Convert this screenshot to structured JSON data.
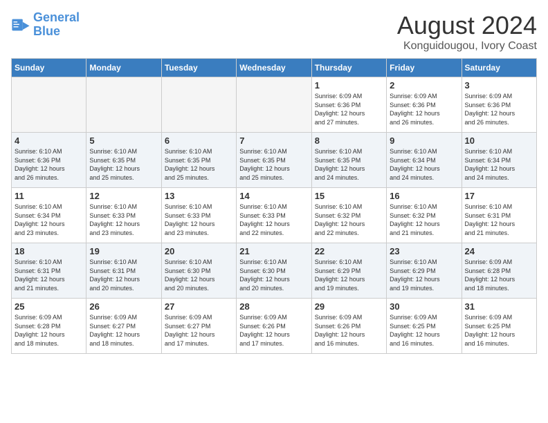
{
  "header": {
    "logo_line1": "General",
    "logo_line2": "Blue",
    "month_title": "August 2024",
    "location": "Konguidougou, Ivory Coast"
  },
  "weekdays": [
    "Sunday",
    "Monday",
    "Tuesday",
    "Wednesday",
    "Thursday",
    "Friday",
    "Saturday"
  ],
  "weeks": [
    [
      {
        "day": "",
        "info": ""
      },
      {
        "day": "",
        "info": ""
      },
      {
        "day": "",
        "info": ""
      },
      {
        "day": "",
        "info": ""
      },
      {
        "day": "1",
        "info": "Sunrise: 6:09 AM\nSunset: 6:36 PM\nDaylight: 12 hours\nand 27 minutes."
      },
      {
        "day": "2",
        "info": "Sunrise: 6:09 AM\nSunset: 6:36 PM\nDaylight: 12 hours\nand 26 minutes."
      },
      {
        "day": "3",
        "info": "Sunrise: 6:09 AM\nSunset: 6:36 PM\nDaylight: 12 hours\nand 26 minutes."
      }
    ],
    [
      {
        "day": "4",
        "info": "Sunrise: 6:10 AM\nSunset: 6:36 PM\nDaylight: 12 hours\nand 26 minutes."
      },
      {
        "day": "5",
        "info": "Sunrise: 6:10 AM\nSunset: 6:35 PM\nDaylight: 12 hours\nand 25 minutes."
      },
      {
        "day": "6",
        "info": "Sunrise: 6:10 AM\nSunset: 6:35 PM\nDaylight: 12 hours\nand 25 minutes."
      },
      {
        "day": "7",
        "info": "Sunrise: 6:10 AM\nSunset: 6:35 PM\nDaylight: 12 hours\nand 25 minutes."
      },
      {
        "day": "8",
        "info": "Sunrise: 6:10 AM\nSunset: 6:35 PM\nDaylight: 12 hours\nand 24 minutes."
      },
      {
        "day": "9",
        "info": "Sunrise: 6:10 AM\nSunset: 6:34 PM\nDaylight: 12 hours\nand 24 minutes."
      },
      {
        "day": "10",
        "info": "Sunrise: 6:10 AM\nSunset: 6:34 PM\nDaylight: 12 hours\nand 24 minutes."
      }
    ],
    [
      {
        "day": "11",
        "info": "Sunrise: 6:10 AM\nSunset: 6:34 PM\nDaylight: 12 hours\nand 23 minutes."
      },
      {
        "day": "12",
        "info": "Sunrise: 6:10 AM\nSunset: 6:33 PM\nDaylight: 12 hours\nand 23 minutes."
      },
      {
        "day": "13",
        "info": "Sunrise: 6:10 AM\nSunset: 6:33 PM\nDaylight: 12 hours\nand 23 minutes."
      },
      {
        "day": "14",
        "info": "Sunrise: 6:10 AM\nSunset: 6:33 PM\nDaylight: 12 hours\nand 22 minutes."
      },
      {
        "day": "15",
        "info": "Sunrise: 6:10 AM\nSunset: 6:32 PM\nDaylight: 12 hours\nand 22 minutes."
      },
      {
        "day": "16",
        "info": "Sunrise: 6:10 AM\nSunset: 6:32 PM\nDaylight: 12 hours\nand 21 minutes."
      },
      {
        "day": "17",
        "info": "Sunrise: 6:10 AM\nSunset: 6:31 PM\nDaylight: 12 hours\nand 21 minutes."
      }
    ],
    [
      {
        "day": "18",
        "info": "Sunrise: 6:10 AM\nSunset: 6:31 PM\nDaylight: 12 hours\nand 21 minutes."
      },
      {
        "day": "19",
        "info": "Sunrise: 6:10 AM\nSunset: 6:31 PM\nDaylight: 12 hours\nand 20 minutes."
      },
      {
        "day": "20",
        "info": "Sunrise: 6:10 AM\nSunset: 6:30 PM\nDaylight: 12 hours\nand 20 minutes."
      },
      {
        "day": "21",
        "info": "Sunrise: 6:10 AM\nSunset: 6:30 PM\nDaylight: 12 hours\nand 20 minutes."
      },
      {
        "day": "22",
        "info": "Sunrise: 6:10 AM\nSunset: 6:29 PM\nDaylight: 12 hours\nand 19 minutes."
      },
      {
        "day": "23",
        "info": "Sunrise: 6:10 AM\nSunset: 6:29 PM\nDaylight: 12 hours\nand 19 minutes."
      },
      {
        "day": "24",
        "info": "Sunrise: 6:09 AM\nSunset: 6:28 PM\nDaylight: 12 hours\nand 18 minutes."
      }
    ],
    [
      {
        "day": "25",
        "info": "Sunrise: 6:09 AM\nSunset: 6:28 PM\nDaylight: 12 hours\nand 18 minutes."
      },
      {
        "day": "26",
        "info": "Sunrise: 6:09 AM\nSunset: 6:27 PM\nDaylight: 12 hours\nand 18 minutes."
      },
      {
        "day": "27",
        "info": "Sunrise: 6:09 AM\nSunset: 6:27 PM\nDaylight: 12 hours\nand 17 minutes."
      },
      {
        "day": "28",
        "info": "Sunrise: 6:09 AM\nSunset: 6:26 PM\nDaylight: 12 hours\nand 17 minutes."
      },
      {
        "day": "29",
        "info": "Sunrise: 6:09 AM\nSunset: 6:26 PM\nDaylight: 12 hours\nand 16 minutes."
      },
      {
        "day": "30",
        "info": "Sunrise: 6:09 AM\nSunset: 6:25 PM\nDaylight: 12 hours\nand 16 minutes."
      },
      {
        "day": "31",
        "info": "Sunrise: 6:09 AM\nSunset: 6:25 PM\nDaylight: 12 hours\nand 16 minutes."
      }
    ]
  ]
}
